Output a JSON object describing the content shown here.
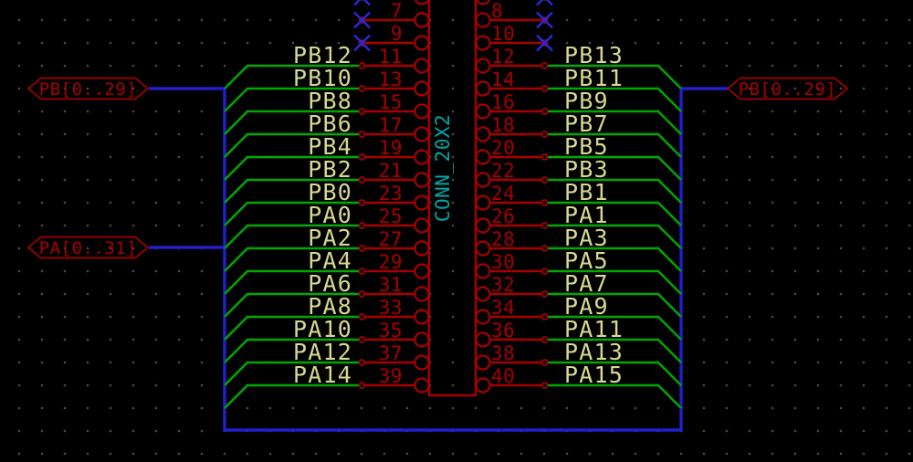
{
  "app": {
    "view": "schematic-editor-canvas"
  },
  "colors": {
    "background": "#000000",
    "grid_dot": "#4a4a4a",
    "symbol_red": "#a60000",
    "wire_green": "#00a800",
    "bus_blue": "#2020cc",
    "label_yellow": "#d8d890",
    "value_teal": "#00a8a8",
    "nc_blue": "#2828dd"
  },
  "component": {
    "value": "CONN_20X2"
  },
  "hierarchical_labels": [
    {
      "id": "pb-left",
      "text": "PB[0..29]"
    },
    {
      "id": "pa-left",
      "text": "PA[0..31]"
    },
    {
      "id": "pb-right",
      "text": "PB[0..29]"
    }
  ],
  "rows": [
    {
      "left_pin": "7",
      "right_pin": "8",
      "left_label": "",
      "right_label": "",
      "no_connect": true
    },
    {
      "left_pin": "9",
      "right_pin": "10",
      "left_label": "",
      "right_label": "",
      "no_connect": true
    },
    {
      "left_pin": "11",
      "right_pin": "12",
      "left_label": "PB12",
      "right_label": "PB13",
      "no_connect": false
    },
    {
      "left_pin": "13",
      "right_pin": "14",
      "left_label": "PB10",
      "right_label": "PB11",
      "no_connect": false
    },
    {
      "left_pin": "15",
      "right_pin": "16",
      "left_label": "PB8",
      "right_label": "PB9",
      "no_connect": false
    },
    {
      "left_pin": "17",
      "right_pin": "18",
      "left_label": "PB6",
      "right_label": "PB7",
      "no_connect": false
    },
    {
      "left_pin": "19",
      "right_pin": "20",
      "left_label": "PB4",
      "right_label": "PB5",
      "no_connect": false
    },
    {
      "left_pin": "21",
      "right_pin": "22",
      "left_label": "PB2",
      "right_label": "PB3",
      "no_connect": false
    },
    {
      "left_pin": "23",
      "right_pin": "24",
      "left_label": "PB0",
      "right_label": "PB1",
      "no_connect": false
    },
    {
      "left_pin": "25",
      "right_pin": "26",
      "left_label": "PA0",
      "right_label": "PA1",
      "no_connect": false
    },
    {
      "left_pin": "27",
      "right_pin": "28",
      "left_label": "PA2",
      "right_label": "PA3",
      "no_connect": false
    },
    {
      "left_pin": "29",
      "right_pin": "30",
      "left_label": "PA4",
      "right_label": "PA5",
      "no_connect": false
    },
    {
      "left_pin": "31",
      "right_pin": "32",
      "left_label": "PA6",
      "right_label": "PA7",
      "no_connect": false
    },
    {
      "left_pin": "33",
      "right_pin": "34",
      "left_label": "PA8",
      "right_label": "PA9",
      "no_connect": false
    },
    {
      "left_pin": "35",
      "right_pin": "36",
      "left_label": "PA10",
      "right_label": "PA11",
      "no_connect": false
    },
    {
      "left_pin": "37",
      "right_pin": "38",
      "left_label": "PA12",
      "right_label": "PA13",
      "no_connect": false
    },
    {
      "left_pin": "39",
      "right_pin": "40",
      "left_label": "PA14",
      "right_label": "PA15",
      "no_connect": false
    }
  ]
}
